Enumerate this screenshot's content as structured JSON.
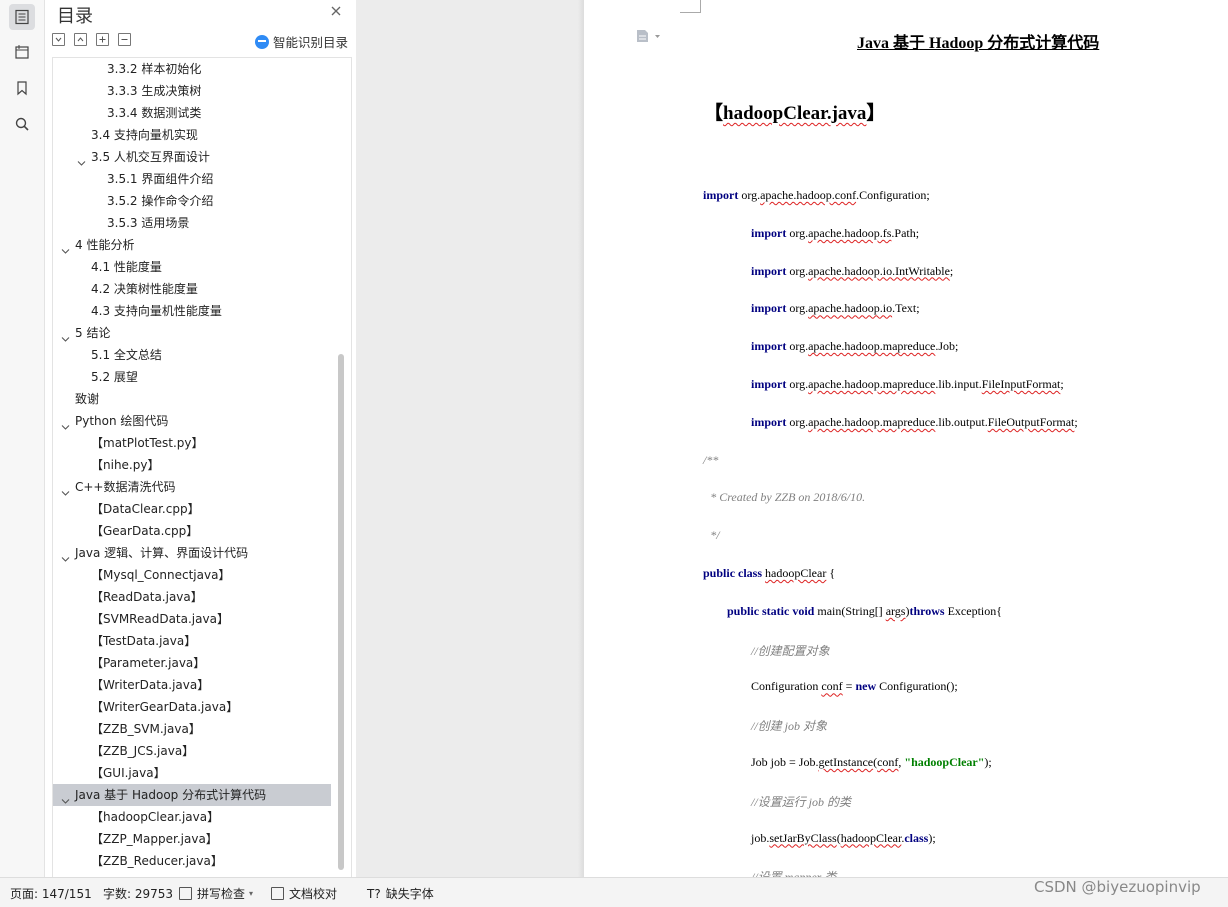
{
  "rail": {
    "icons": [
      "toc-icon",
      "navigation-icon",
      "bookmark-icon",
      "search-icon"
    ]
  },
  "toc": {
    "title": "目录",
    "smart_label": "智能识别目录",
    "items": [
      {
        "text": "3.3.2  样本初始化",
        "level": 3,
        "chevron": false
      },
      {
        "text": "3.3.3  生成决策树",
        "level": 3,
        "chevron": false
      },
      {
        "text": "3.3.4  数据测试类",
        "level": 3,
        "chevron": false
      },
      {
        "text": "3.4  支持向量机实现",
        "level": 2,
        "chevron": false
      },
      {
        "text": "3.5  人机交互界面设计",
        "level": 2,
        "chevron": true
      },
      {
        "text": "3.5.1  界面组件介绍",
        "level": 3,
        "chevron": false
      },
      {
        "text": "3.5.2  操作命令介绍",
        "level": 3,
        "chevron": false
      },
      {
        "text": "3.5.3  适用场景",
        "level": 3,
        "chevron": false
      },
      {
        "text": "4  性能分析",
        "level": 1,
        "chevron": true
      },
      {
        "text": "4.1  性能度量",
        "level": 2,
        "chevron": false
      },
      {
        "text": "4.2  决策树性能度量",
        "level": 2,
        "chevron": false
      },
      {
        "text": "4.3  支持向量机性能度量",
        "level": 2,
        "chevron": false
      },
      {
        "text": "5  结论",
        "level": 1,
        "chevron": true
      },
      {
        "text": "5.1  全文总结",
        "level": 2,
        "chevron": false
      },
      {
        "text": "5.2  展望",
        "level": 2,
        "chevron": false
      },
      {
        "text": "致谢",
        "level": 1,
        "chevron": false
      },
      {
        "text": "Python 绘图代码",
        "level": 1,
        "chevron": true
      },
      {
        "text": "【matPlotTest.py】",
        "level": 2,
        "chevron": false
      },
      {
        "text": "【nihe.py】",
        "level": 2,
        "chevron": false
      },
      {
        "text": "C++数据清洗代码",
        "level": 1,
        "chevron": true
      },
      {
        "text": "【DataClear.cpp】",
        "level": 2,
        "chevron": false
      },
      {
        "text": "【GearData.cpp】",
        "level": 2,
        "chevron": false
      },
      {
        "text": "Java  逻辑、计算、界面设计代码",
        "level": 1,
        "chevron": true
      },
      {
        "text": "【Mysql_Connectjava】",
        "level": 2,
        "chevron": false
      },
      {
        "text": "【ReadData.java】",
        "level": 2,
        "chevron": false
      },
      {
        "text": "【SVMReadData.java】",
        "level": 2,
        "chevron": false
      },
      {
        "text": "【TestData.java】",
        "level": 2,
        "chevron": false
      },
      {
        "text": "【Parameter.java】",
        "level": 2,
        "chevron": false
      },
      {
        "text": "【WriterData.java】",
        "level": 2,
        "chevron": false
      },
      {
        "text": "【WriterGearData.java】",
        "level": 2,
        "chevron": false
      },
      {
        "text": "【ZZB_SVM.java】",
        "level": 2,
        "chevron": false
      },
      {
        "text": "【ZZB_JCS.java】",
        "level": 2,
        "chevron": false
      },
      {
        "text": "【GUI.java】",
        "level": 2,
        "chevron": false
      },
      {
        "text": "Java  基于 Hadoop 分布式计算代码",
        "level": 1,
        "chevron": true,
        "selected": true
      },
      {
        "text": "【hadoopClear.java】",
        "level": 2,
        "chevron": false
      },
      {
        "text": "【ZZP_Mapper.java】",
        "level": 2,
        "chevron": false
      },
      {
        "text": "【ZZB_Reducer.java】",
        "level": 2,
        "chevron": false
      }
    ]
  },
  "doc": {
    "title": "Java  基于 Hadoop 分布式计算代码",
    "file_head": "hadoopClear.java",
    "bracket_open": "【",
    "bracket_close": "】",
    "lines": [
      {
        "indent": 0,
        "parts": [
          {
            "t": "import",
            "c": "kw"
          },
          {
            "t": " org.",
            "c": ""
          },
          {
            "t": "apache.hadoop.conf",
            "c": "sq"
          },
          {
            "t": ".Configuration;",
            "c": ""
          }
        ]
      },
      {
        "indent": 1,
        "parts": [
          {
            "t": "import",
            "c": "kw"
          },
          {
            "t": " org.",
            "c": ""
          },
          {
            "t": "apache.hadoop.fs",
            "c": "sq"
          },
          {
            "t": ".Path;",
            "c": ""
          }
        ]
      },
      {
        "indent": 1,
        "parts": [
          {
            "t": "import",
            "c": "kw"
          },
          {
            "t": " org.",
            "c": ""
          },
          {
            "t": "apache.hadoop.io.IntWritable",
            "c": "sq"
          },
          {
            "t": ";",
            "c": ""
          }
        ]
      },
      {
        "indent": 1,
        "parts": [
          {
            "t": "import",
            "c": "kw"
          },
          {
            "t": " org.",
            "c": ""
          },
          {
            "t": "apache.hadoop.io",
            "c": "sq"
          },
          {
            "t": ".Text;",
            "c": ""
          }
        ]
      },
      {
        "indent": 1,
        "parts": [
          {
            "t": "import",
            "c": "kw"
          },
          {
            "t": " org.",
            "c": ""
          },
          {
            "t": "apache.hadoop.mapreduce",
            "c": "sq"
          },
          {
            "t": ".Job;",
            "c": ""
          }
        ]
      },
      {
        "indent": 1,
        "parts": [
          {
            "t": "import",
            "c": "kw"
          },
          {
            "t": " org.",
            "c": ""
          },
          {
            "t": "apache.hadoop.mapreduce",
            "c": "sq"
          },
          {
            "t": ".lib.input.",
            "c": ""
          },
          {
            "t": "FileInputFormat",
            "c": "sq"
          },
          {
            "t": ";",
            "c": ""
          }
        ]
      },
      {
        "indent": 1,
        "parts": [
          {
            "t": "import",
            "c": "kw"
          },
          {
            "t": " org.",
            "c": ""
          },
          {
            "t": "apache.hadoop.mapreduce",
            "c": "sq"
          },
          {
            "t": ".lib.output.",
            "c": ""
          },
          {
            "t": "FileOutputFormat",
            "c": "sq"
          },
          {
            "t": ";",
            "c": ""
          }
        ]
      },
      {
        "indent": 0,
        "parts": [
          {
            "t": "/**",
            "c": "cm"
          }
        ]
      },
      {
        "indent": 0.15,
        "parts": [
          {
            "t": "* Created by    ZZB on 2018/6/10.",
            "c": "cm"
          }
        ]
      },
      {
        "indent": 0.15,
        "parts": [
          {
            "t": "*/",
            "c": "cm"
          }
        ]
      },
      {
        "indent": 0,
        "parts": [
          {
            "t": "public class",
            "c": "kw"
          },
          {
            "t": " ",
            "c": ""
          },
          {
            "t": "hadoopClear",
            "c": "sq"
          },
          {
            "t": " {",
            "c": ""
          }
        ]
      },
      {
        "indent": 0.5,
        "parts": [
          {
            "t": "public static void",
            "c": "kw"
          },
          {
            "t": " main(String[] ",
            "c": ""
          },
          {
            "t": "args",
            "c": "sq"
          },
          {
            "t": ")",
            "c": ""
          },
          {
            "t": "throws",
            "c": "kw"
          },
          {
            "t": " Exception{",
            "c": ""
          }
        ]
      },
      {
        "indent": 1,
        "parts": [
          {
            "t": "//创建配置对象",
            "c": "cm"
          }
        ]
      },
      {
        "indent": 1,
        "parts": [
          {
            "t": "Configuration ",
            "c": ""
          },
          {
            "t": "conf",
            "c": "sq"
          },
          {
            "t": " = ",
            "c": ""
          },
          {
            "t": "new",
            "c": "kw"
          },
          {
            "t": " Configuration();",
            "c": ""
          }
        ]
      },
      {
        "indent": 1,
        "parts": [
          {
            "t": "//创建 job 对象",
            "c": "cm"
          }
        ]
      },
      {
        "indent": 1,
        "parts": [
          {
            "t": "Job job = Job.",
            "c": ""
          },
          {
            "t": "getInstance",
            "c": "sq"
          },
          {
            "t": "(",
            "c": ""
          },
          {
            "t": "conf",
            "c": "sq"
          },
          {
            "t": ", ",
            "c": ""
          },
          {
            "t": "\"hadoopClear\"",
            "c": "str"
          },
          {
            "t": ");",
            "c": ""
          }
        ]
      },
      {
        "indent": 1,
        "parts": [
          {
            "t": "//设置运行 job 的类",
            "c": "cm"
          }
        ]
      },
      {
        "indent": 1,
        "parts": [
          {
            "t": "job.",
            "c": ""
          },
          {
            "t": "setJarByClass",
            "c": "sq"
          },
          {
            "t": "(",
            "c": ""
          },
          {
            "t": "hadoopClear",
            "c": "sq"
          },
          {
            "t": ".",
            "c": ""
          },
          {
            "t": "class",
            "c": "kw"
          },
          {
            "t": ");",
            "c": ""
          }
        ]
      },
      {
        "indent": 1,
        "parts": [
          {
            "t": "//设置 mapper  类",
            "c": "cm"
          }
        ]
      }
    ]
  },
  "status": {
    "page": "页面: 147/151",
    "words": "字数: 29753",
    "spell": "拼写检查",
    "proof": "文档校对",
    "font": "缺失字体"
  },
  "watermark": "CSDN @biyezuopinvip"
}
